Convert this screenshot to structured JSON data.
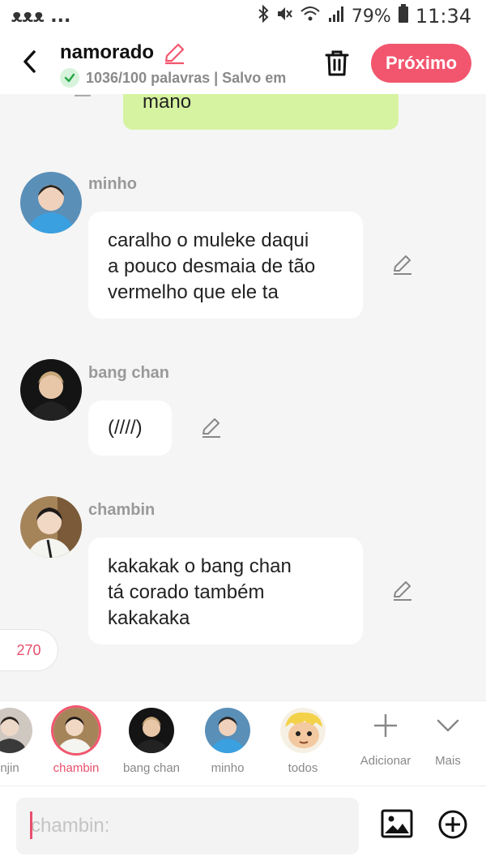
{
  "status_bar": {
    "notifications": "ᴥᴥᴥ ...",
    "battery": "79%",
    "time": "11:34"
  },
  "header": {
    "title": "namorado",
    "save_status": "1036/100 palavras | Salvo em",
    "next_label": "Próximo",
    "accent": "#f2566e"
  },
  "chat": {
    "top_bubble_text": "mano",
    "messages": [
      {
        "sender": "minho",
        "text_lines": [
          "caralho o muleke daqui",
          "a pouco desmaia de tão",
          "vermelho que ele ta"
        ]
      },
      {
        "sender": "bang chan",
        "text_lines": [
          "(////)"
        ]
      },
      {
        "sender": "chambin",
        "text_lines": [
          "kakakak o bang chan",
          "tá corado também",
          "kakakaka"
        ]
      }
    ],
    "count": "270"
  },
  "characters": {
    "items": [
      {
        "name": "njin"
      },
      {
        "name": "chambin"
      },
      {
        "name": "bang chan"
      },
      {
        "name": "minho"
      },
      {
        "name": "todos"
      }
    ],
    "add_label": "Adicionar",
    "more_label": "Mais"
  },
  "composer": {
    "placeholder": "chambin:"
  }
}
